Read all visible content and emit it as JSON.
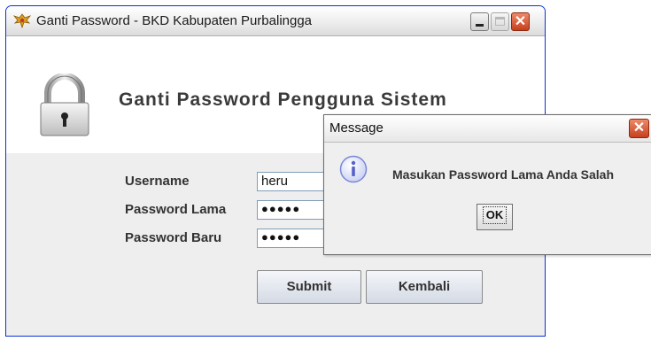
{
  "window": {
    "title": "Ganti Password - BKD Kabupaten Purbalingga",
    "close_glyph": "✕"
  },
  "header": {
    "title": "Ganti Password Pengguna Sistem",
    "icon": "padlock-icon"
  },
  "form": {
    "username_label": "Username",
    "username_value": "heru",
    "old_password_label": "Password Lama",
    "old_password_value": "●●●●●",
    "new_password_label": "Password Baru",
    "new_password_value": "●●●●●",
    "submit_label": "Submit",
    "back_label": "Kembali"
  },
  "dialog": {
    "title": "Message",
    "close_glyph": "✕",
    "message": "Masukan Password Lama Anda Salah",
    "ok_label": "OK",
    "icon": "info-icon"
  },
  "colors": {
    "accent": "#0831d9",
    "close_button": "#c5401e",
    "info_icon": "#7a87d6"
  }
}
